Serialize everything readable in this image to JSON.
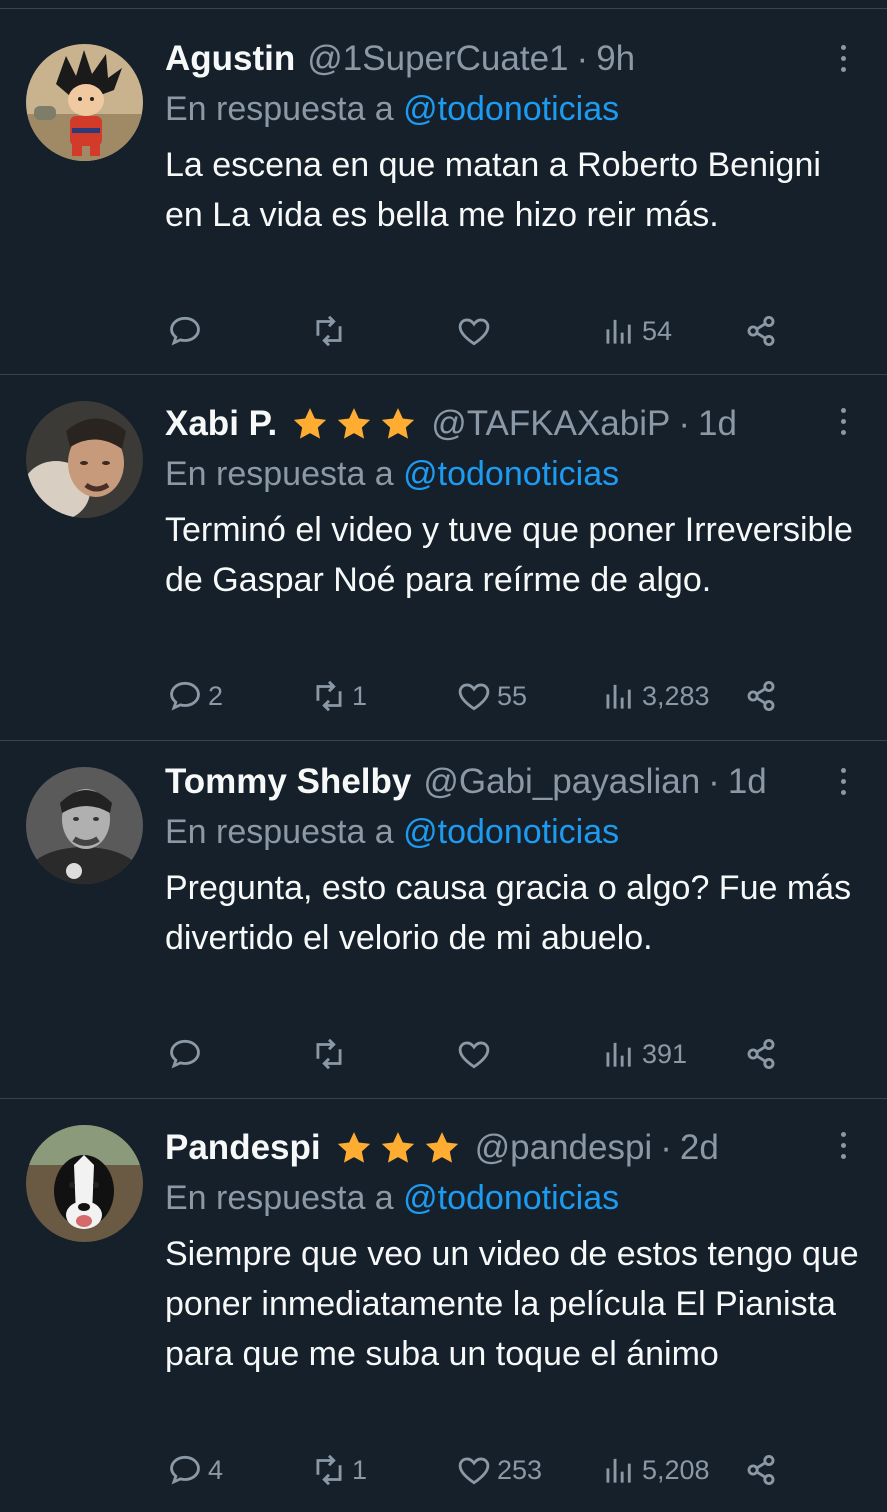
{
  "reply_prefix": "En respuesta a",
  "colors": {
    "background": "#15202b",
    "text": "#f7f9f9",
    "muted": "#8b98a5",
    "accent": "#1d9bf0",
    "star": "#ffac33",
    "divider": "#38444d"
  },
  "icons": {
    "reply": "comment-icon",
    "retweet": "retweet-icon",
    "like": "heart-icon",
    "views": "views-icon",
    "share": "share-icon",
    "more": "more-vertical-icon",
    "badge": "star-icon"
  },
  "tweets": [
    {
      "name": "Agustin",
      "stars": 0,
      "handle": "@1SuperCuate1",
      "time": "9h",
      "mention": "@todonoticias",
      "text": "La escena en que matan a Roberto Benigni en La vida es bella me hizo reir más.",
      "replies": "",
      "retweets": "",
      "likes": "",
      "views": "54"
    },
    {
      "name": "Xabi P.",
      "stars": 3,
      "handle": "@TAFKAXabiP",
      "time": "1d",
      "mention": "@todonoticias",
      "text": "Terminó el video y tuve que poner Irreversible de Gaspar Noé para reírme de algo.",
      "replies": "2",
      "retweets": "1",
      "likes": "55",
      "views": "3,283"
    },
    {
      "name": "Tommy Shelby",
      "stars": 0,
      "handle": "@Gabi_payaslian",
      "time": "1d",
      "mention": "@todonoticias",
      "text": "Pregunta, esto causa gracia o algo? Fue más divertido el velorio de mi abuelo.",
      "replies": "",
      "retweets": "",
      "likes": "",
      "views": "391"
    },
    {
      "name": "Pandespi",
      "stars": 3,
      "handle": "@pandespi",
      "time": "2d",
      "mention": "@todonoticias",
      "text": "Siempre que veo un video de estos tengo que poner inmediatamente la película El Pianista para que me suba un toque el ánimo",
      "replies": "4",
      "retweets": "1",
      "likes": "253",
      "views": "5,208"
    }
  ]
}
